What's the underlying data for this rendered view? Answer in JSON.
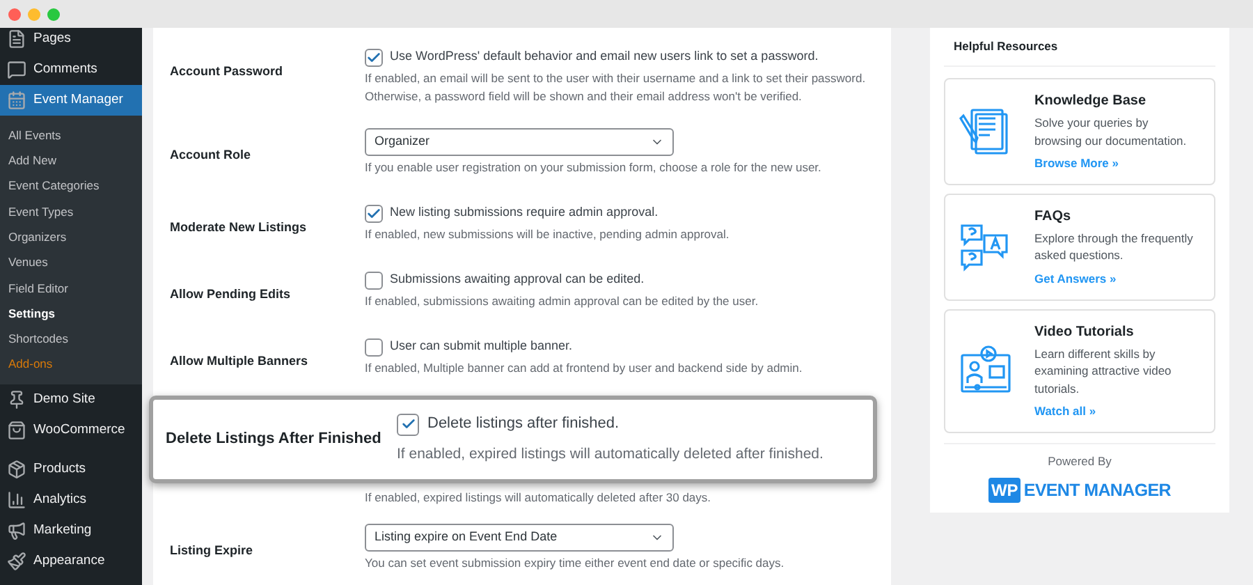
{
  "sidebar": {
    "items": [
      {
        "label": "Pages",
        "selected": false
      },
      {
        "label": "Comments",
        "selected": false
      },
      {
        "label": "Event Manager",
        "selected": true,
        "children": [
          {
            "label": "All Events",
            "selected": false,
            "kind": "normal"
          },
          {
            "label": "Add New",
            "selected": false,
            "kind": "normal"
          },
          {
            "label": "Event Categories",
            "selected": false,
            "kind": "normal"
          },
          {
            "label": "Event Types",
            "selected": false,
            "kind": "normal"
          },
          {
            "label": "Organizers",
            "selected": false,
            "kind": "normal"
          },
          {
            "label": "Venues",
            "selected": false,
            "kind": "normal"
          },
          {
            "label": "Field Editor",
            "selected": false,
            "kind": "normal"
          },
          {
            "label": "Settings",
            "selected": true,
            "kind": "normal"
          },
          {
            "label": "Shortcodes",
            "selected": false,
            "kind": "normal"
          },
          {
            "label": "Add-ons",
            "selected": false,
            "kind": "addon"
          }
        ]
      },
      {
        "label": "Demo Site",
        "selected": false
      },
      {
        "label": "WooCommerce",
        "selected": false
      },
      {
        "label": "Products",
        "selected": false
      },
      {
        "label": "Analytics",
        "selected": false
      },
      {
        "label": "Marketing",
        "selected": false
      },
      {
        "label": "Appearance",
        "selected": false
      }
    ]
  },
  "settings": [
    {
      "label": "Account Password",
      "kind": "checkbox",
      "checked": true,
      "option": "Use WordPress' default behavior and email new users link to set a password.",
      "description": [
        "If enabled, an email will be sent to the user with their username and a link to set their password.",
        "Otherwise, a password field will be shown and their email address won't be verified."
      ]
    },
    {
      "label": "Account Role",
      "kind": "select",
      "value": "Organizer",
      "description": [
        "If you enable user registration on your submission form, choose a role for the new user."
      ]
    },
    {
      "label": "Moderate New Listings",
      "kind": "checkbox",
      "checked": true,
      "option": "New listing submissions require admin approval.",
      "description": [
        "If enabled, new submissions will be inactive, pending admin approval."
      ]
    },
    {
      "label": "Allow Pending Edits",
      "kind": "checkbox",
      "checked": false,
      "option": "Submissions awaiting approval can be edited.",
      "description": [
        "If enabled, submissions awaiting admin approval can be edited by the user."
      ]
    },
    {
      "label": "Allow Multiple Banners",
      "kind": "checkbox",
      "checked": false,
      "option": "User can submit multiple banner.",
      "description": [
        "If enabled, Multiple banner can add at frontend by user and backend side by admin."
      ]
    },
    {
      "kind": "covered",
      "description": [
        "If enabled, expired listings will automatically deleted after 30 days."
      ]
    },
    {
      "label": "Listing Expire",
      "kind": "select",
      "value": "Listing expire on Event End Date",
      "description": [
        "You can set event submission expiry time either event end date or specific days."
      ]
    }
  ],
  "highlight": {
    "label": "Delete Listings After Finished",
    "checked": true,
    "option": "Delete listings after finished.",
    "description": "If enabled, expired listings will automatically deleted after finished."
  },
  "resources": {
    "title": "Helpful Resources",
    "cards": [
      {
        "title": "Knowledge Base",
        "text": "Solve your queries by browsing our documentation.",
        "link": "Browse More »"
      },
      {
        "title": "FAQs",
        "text": "Explore through the frequently asked questions.",
        "link": "Get Answers »"
      },
      {
        "title": "Video Tutorials",
        "text": "Learn different skills by examining attractive video tutorials.",
        "link": "Watch all »"
      }
    ],
    "powered_by": "Powered By",
    "logo_badge": "WP",
    "logo_text": "EVENT MANAGER"
  }
}
